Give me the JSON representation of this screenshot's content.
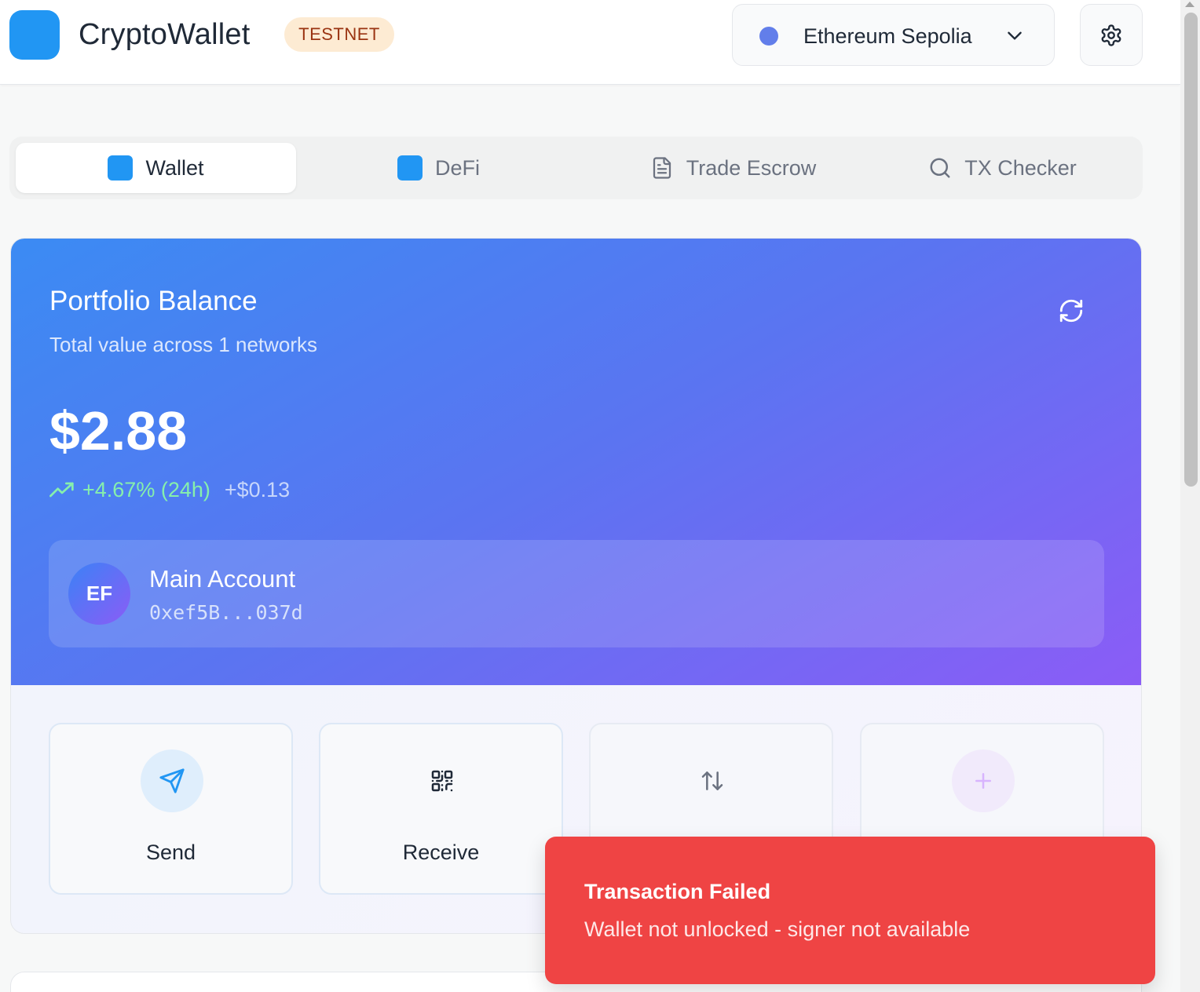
{
  "header": {
    "app_title": "CryptoWallet",
    "badge": "TESTNET",
    "network": {
      "label": "Ethereum Sepolia",
      "dot_color": "#627eea"
    },
    "logo_color": "#2196f3"
  },
  "tabs": [
    {
      "label": "Wallet",
      "icon": "square-icon",
      "active": true
    },
    {
      "label": "DeFi",
      "icon": "square-icon",
      "active": false
    },
    {
      "label": "Trade Escrow",
      "icon": "document-icon",
      "active": false
    },
    {
      "label": "TX Checker",
      "icon": "search-icon",
      "active": false
    }
  ],
  "portfolio": {
    "title": "Portfolio Balance",
    "subtitle": "Total value across 1 networks",
    "amount": "$2.88",
    "change_pct": "+4.67% (24h)",
    "change_abs": "+$0.13",
    "account": {
      "initials": "EF",
      "name": "Main Account",
      "address": "0xef5B...037d"
    }
  },
  "actions": [
    {
      "label": "Send",
      "icon": "send-icon"
    },
    {
      "label": "Receive",
      "icon": "qr-code-icon"
    },
    {
      "label": "",
      "icon": "swap-arrows-icon"
    },
    {
      "label": "",
      "icon": "plus-icon"
    }
  ],
  "toast": {
    "title": "Transaction Failed",
    "message": "Wallet not unlocked - signer not available",
    "color": "#ef4444"
  }
}
